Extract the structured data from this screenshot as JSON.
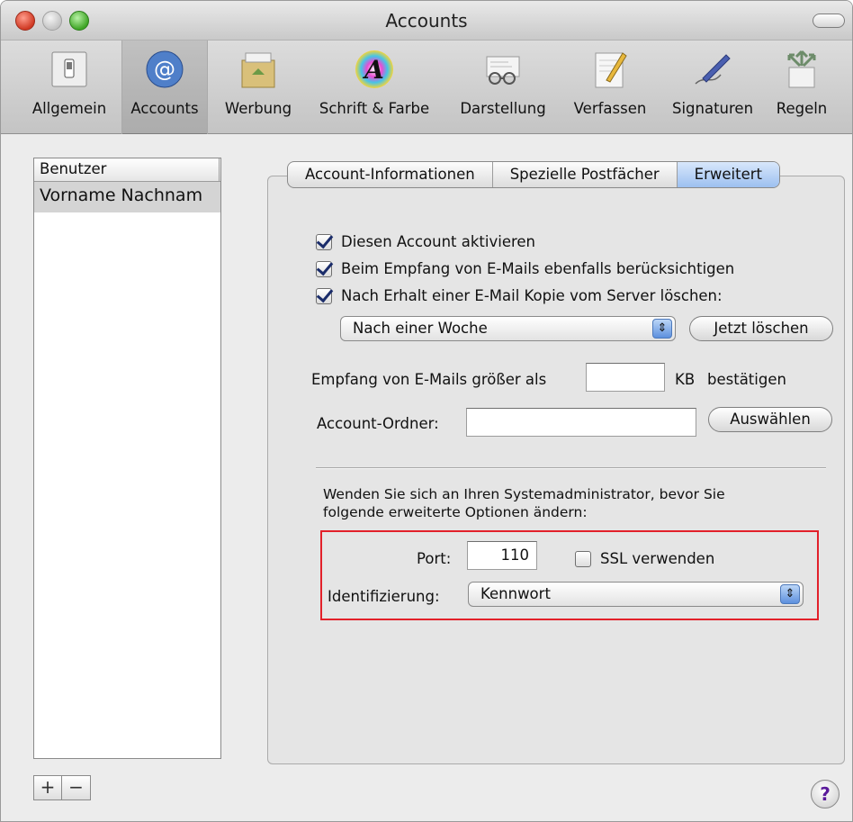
{
  "window": {
    "title": "Accounts"
  },
  "toolbar": {
    "items": [
      {
        "label": "Allgemein",
        "icon": "switch-icon"
      },
      {
        "label": "Accounts",
        "icon": "at-sign-icon",
        "selected": true
      },
      {
        "label": "Werbung",
        "icon": "trash-box-icon"
      },
      {
        "label": "Schrift & Farbe",
        "icon": "font-color-icon"
      },
      {
        "label": "Darstellung",
        "icon": "glasses-icon"
      },
      {
        "label": "Verfassen",
        "icon": "pencil-paper-icon"
      },
      {
        "label": "Signaturen",
        "icon": "fountain-pen-icon"
      },
      {
        "label": "Regeln",
        "icon": "rules-arrows-icon"
      }
    ]
  },
  "sidebar": {
    "header": "Benutzer",
    "rows": [
      "Vorname Nachnam"
    ],
    "add_label": "+",
    "remove_label": "−"
  },
  "tabs": [
    {
      "label": "Account-Informationen"
    },
    {
      "label": "Spezielle Postfächer"
    },
    {
      "label": "Erweitert",
      "active": true
    }
  ],
  "advanced": {
    "check_enable": {
      "label": "Diesen Account aktivieren",
      "checked": true
    },
    "check_include": {
      "label": "Beim Empfang von E-Mails ebenfalls berücksichtigen",
      "checked": true
    },
    "check_delete": {
      "label": "Nach Erhalt einer E-Mail Kopie vom Server löschen:",
      "checked": true
    },
    "delete_popup": {
      "value": "Nach einer Woche"
    },
    "delete_now_button": "Jetzt löschen",
    "size_prefix": "Empfang von E-Mails größer als",
    "size_value": "",
    "size_unit": "KB",
    "size_suffix": "bestätigen",
    "folder_label": "Account-Ordner:",
    "folder_value": "",
    "choose_button": "Auswählen",
    "note": "Wenden Sie sich an Ihren Systemadministrator, bevor Sie folgende erweiterte Optionen ändern:",
    "port_label": "Port:",
    "port_value": "110",
    "ssl": {
      "label": "SSL verwenden",
      "checked": false
    },
    "auth_label": "Identifizierung:",
    "auth_popup": {
      "value": "Kennwort"
    }
  },
  "help_label": "?",
  "colors": {
    "highlight": "#e2202a",
    "tab_active": "#9dc0f0",
    "popup_arrow": "#5d90de"
  }
}
